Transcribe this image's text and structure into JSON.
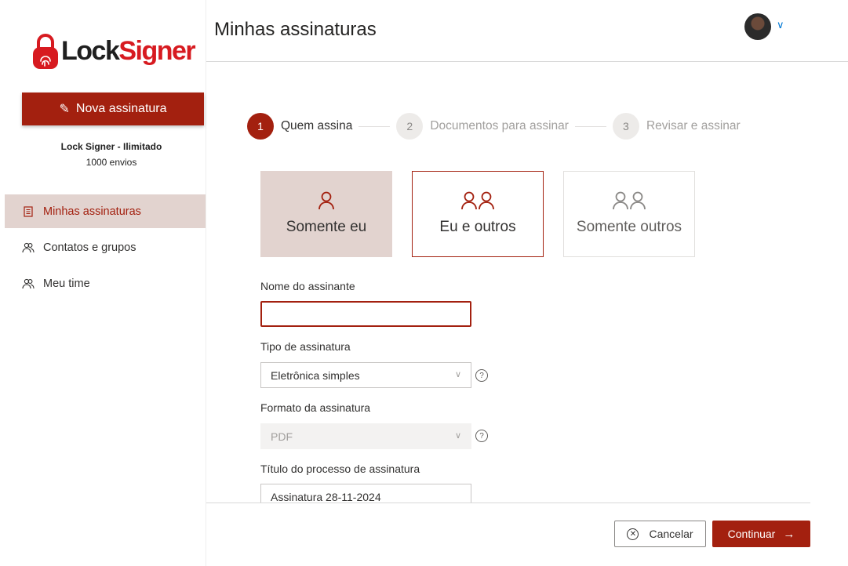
{
  "app": {
    "logo_lock": "Lock",
    "logo_signer": "Signer"
  },
  "sidebar": {
    "new_button_label": "Nova assinatura",
    "plan_name": "Lock Signer - Ilimitado",
    "plan_quota": "1000 envios",
    "items": [
      {
        "label": "Minhas assinaturas",
        "icon": "document-icon",
        "active": true
      },
      {
        "label": "Contatos e grupos",
        "icon": "people-icon",
        "active": false
      },
      {
        "label": "Meu time",
        "icon": "people-icon",
        "active": false
      }
    ]
  },
  "header": {
    "title": "Minhas assinaturas"
  },
  "steps": [
    {
      "num": "1",
      "label": "Quem assina",
      "active": true
    },
    {
      "num": "2",
      "label": "Documentos para assinar",
      "active": false
    },
    {
      "num": "3",
      "label": "Revisar e assinar",
      "active": false
    }
  ],
  "signer_options": [
    {
      "label": "Somente eu",
      "icon": "person-icon",
      "state": "selected"
    },
    {
      "label": "Eu e outros",
      "icon": "people-icon",
      "state": "hover"
    },
    {
      "label": "Somente outros",
      "icon": "people-icon",
      "state": "normal"
    }
  ],
  "form": {
    "signer_name": {
      "label": "Nome do assinante",
      "value": ""
    },
    "signature_type": {
      "label": "Tipo de assinatura",
      "value": "Eletrônica simples"
    },
    "signature_format": {
      "label": "Formato da assinatura",
      "value": "PDF"
    },
    "process_title": {
      "label": "Título do processo de assinatura",
      "value": "Assinatura 28-11-2024"
    }
  },
  "footer": {
    "cancel_label": "Cancelar",
    "continue_label": "Continuar"
  },
  "colors": {
    "brand": "#a3200f",
    "logo_red": "#d71a20",
    "selected_bg": "#e2d3cf"
  }
}
